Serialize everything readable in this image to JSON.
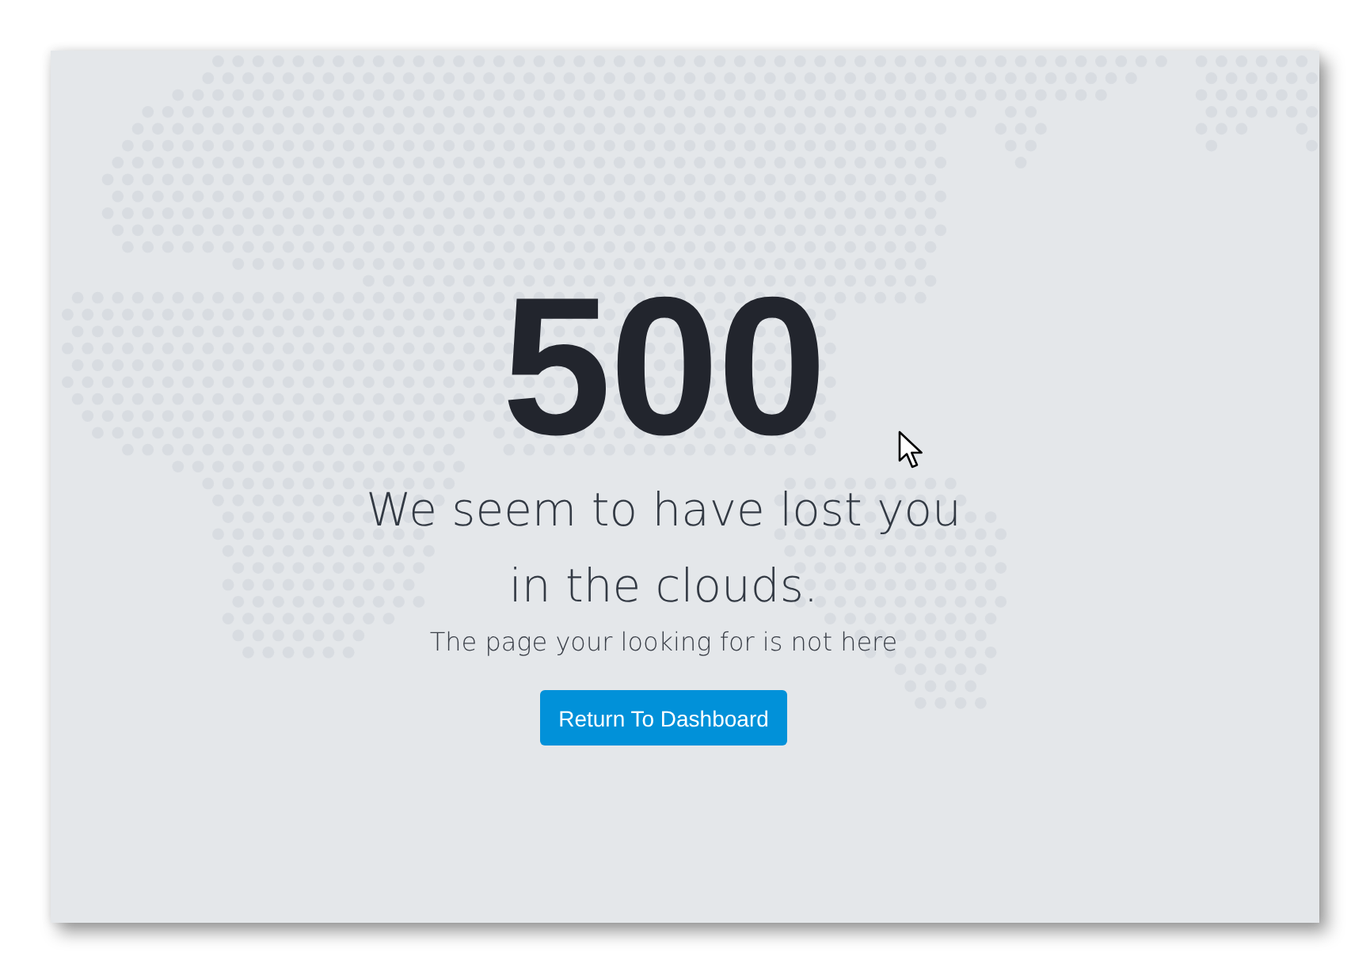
{
  "error_page": {
    "code": "500",
    "headline": "We seem to have lost you in the clouds.",
    "message": "The page your looking for is not here",
    "button": {
      "label": "Return To Dashboard"
    }
  }
}
